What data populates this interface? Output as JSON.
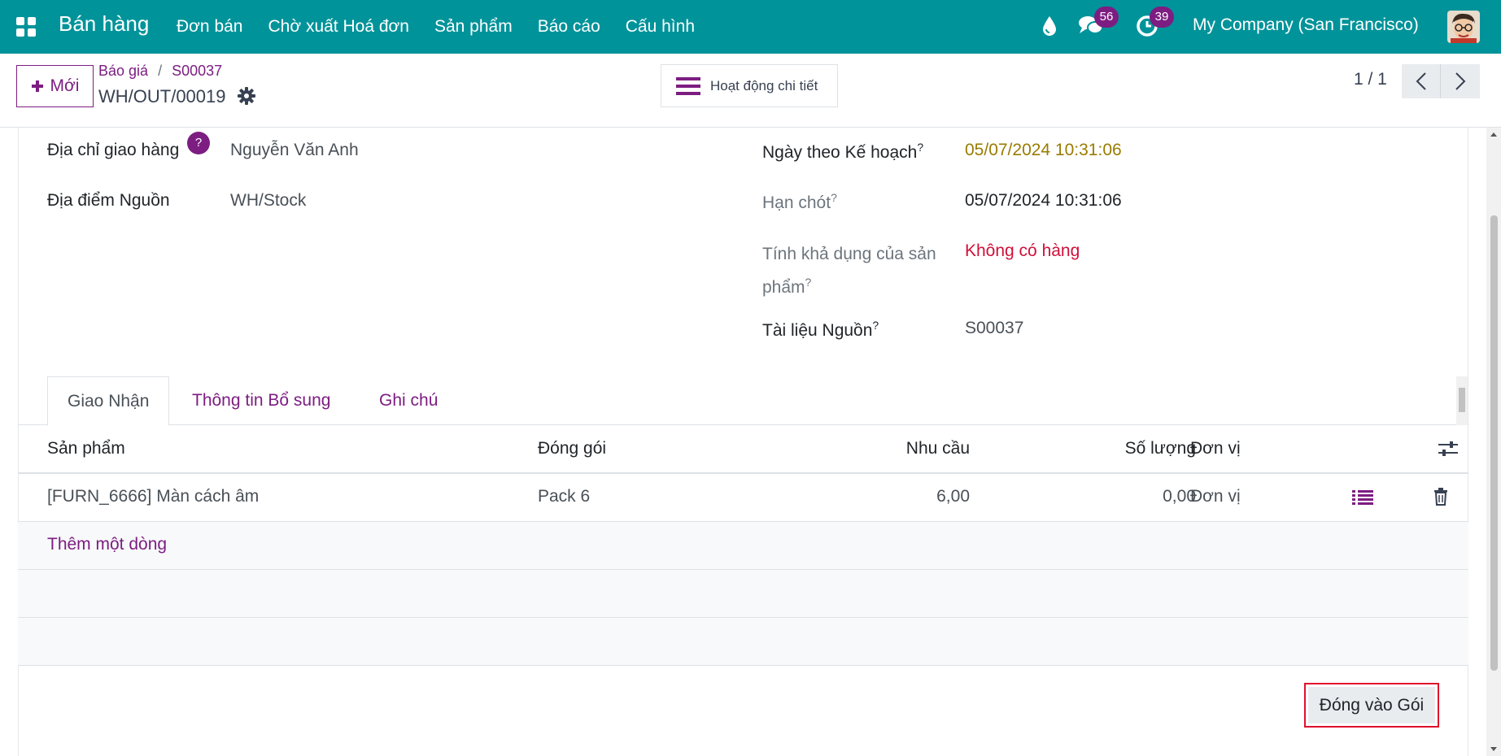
{
  "navbar": {
    "brand": "Bán hàng",
    "menu": [
      "Đơn bán",
      "Chờ xuất Hoá đơn",
      "Sản phẩm",
      "Báo cáo",
      "Cấu hình"
    ],
    "chat_count": "56",
    "activity_count": "39",
    "company": "My Company (San Francisco)"
  },
  "control": {
    "new_label": "Mới",
    "breadcrumb": [
      "Báo giá",
      "S00037"
    ],
    "record_name": "WH/OUT/00019",
    "activity_label": "Hoạt động chi tiết",
    "pager": "1 / 1"
  },
  "form": {
    "delivery_address_label": "Địa chỉ giao hàng",
    "help_mark": "?",
    "delivery_address": "Nguyễn Văn Anh",
    "source_location_label": "Địa điểm Nguồn",
    "source_location": "WH/Stock",
    "scheduled_date_label": "Ngày theo Kế hoạch",
    "scheduled_date": "05/07/2024 10:31:06",
    "deadline_label": "Hạn chót",
    "deadline": "05/07/2024 10:31:06",
    "availability_label_line1": "Tính khả dụng của sản",
    "availability_label_line2": "phẩm",
    "availability": "Không có hàng",
    "source_doc_label": "Tài liệu Nguồn",
    "source_doc": "S00037",
    "tooltip_mark": "?"
  },
  "tabs": [
    "Giao Nhận",
    "Thông tin Bổ sung",
    "Ghi chú"
  ],
  "table": {
    "headers": {
      "product": "Sản phẩm",
      "packaging": "Đóng gói",
      "demand": "Nhu cầu",
      "quantity": "Số lượng",
      "uom": "Đơn vị"
    },
    "rows": [
      {
        "product": "[FURN_6666] Màn cách âm",
        "packaging": "Pack 6",
        "demand": "6,00",
        "quantity": "0,00",
        "uom": "Đơn vị"
      }
    ],
    "add_line": "Thêm một dòng"
  },
  "actions": {
    "put_in_pack": "Đóng vào Gói"
  },
  "colors": {
    "navbar": "#01939a",
    "brand_purple": "#7d1d82",
    "warning_date": "#9a7b00",
    "danger": "#d0103a"
  }
}
